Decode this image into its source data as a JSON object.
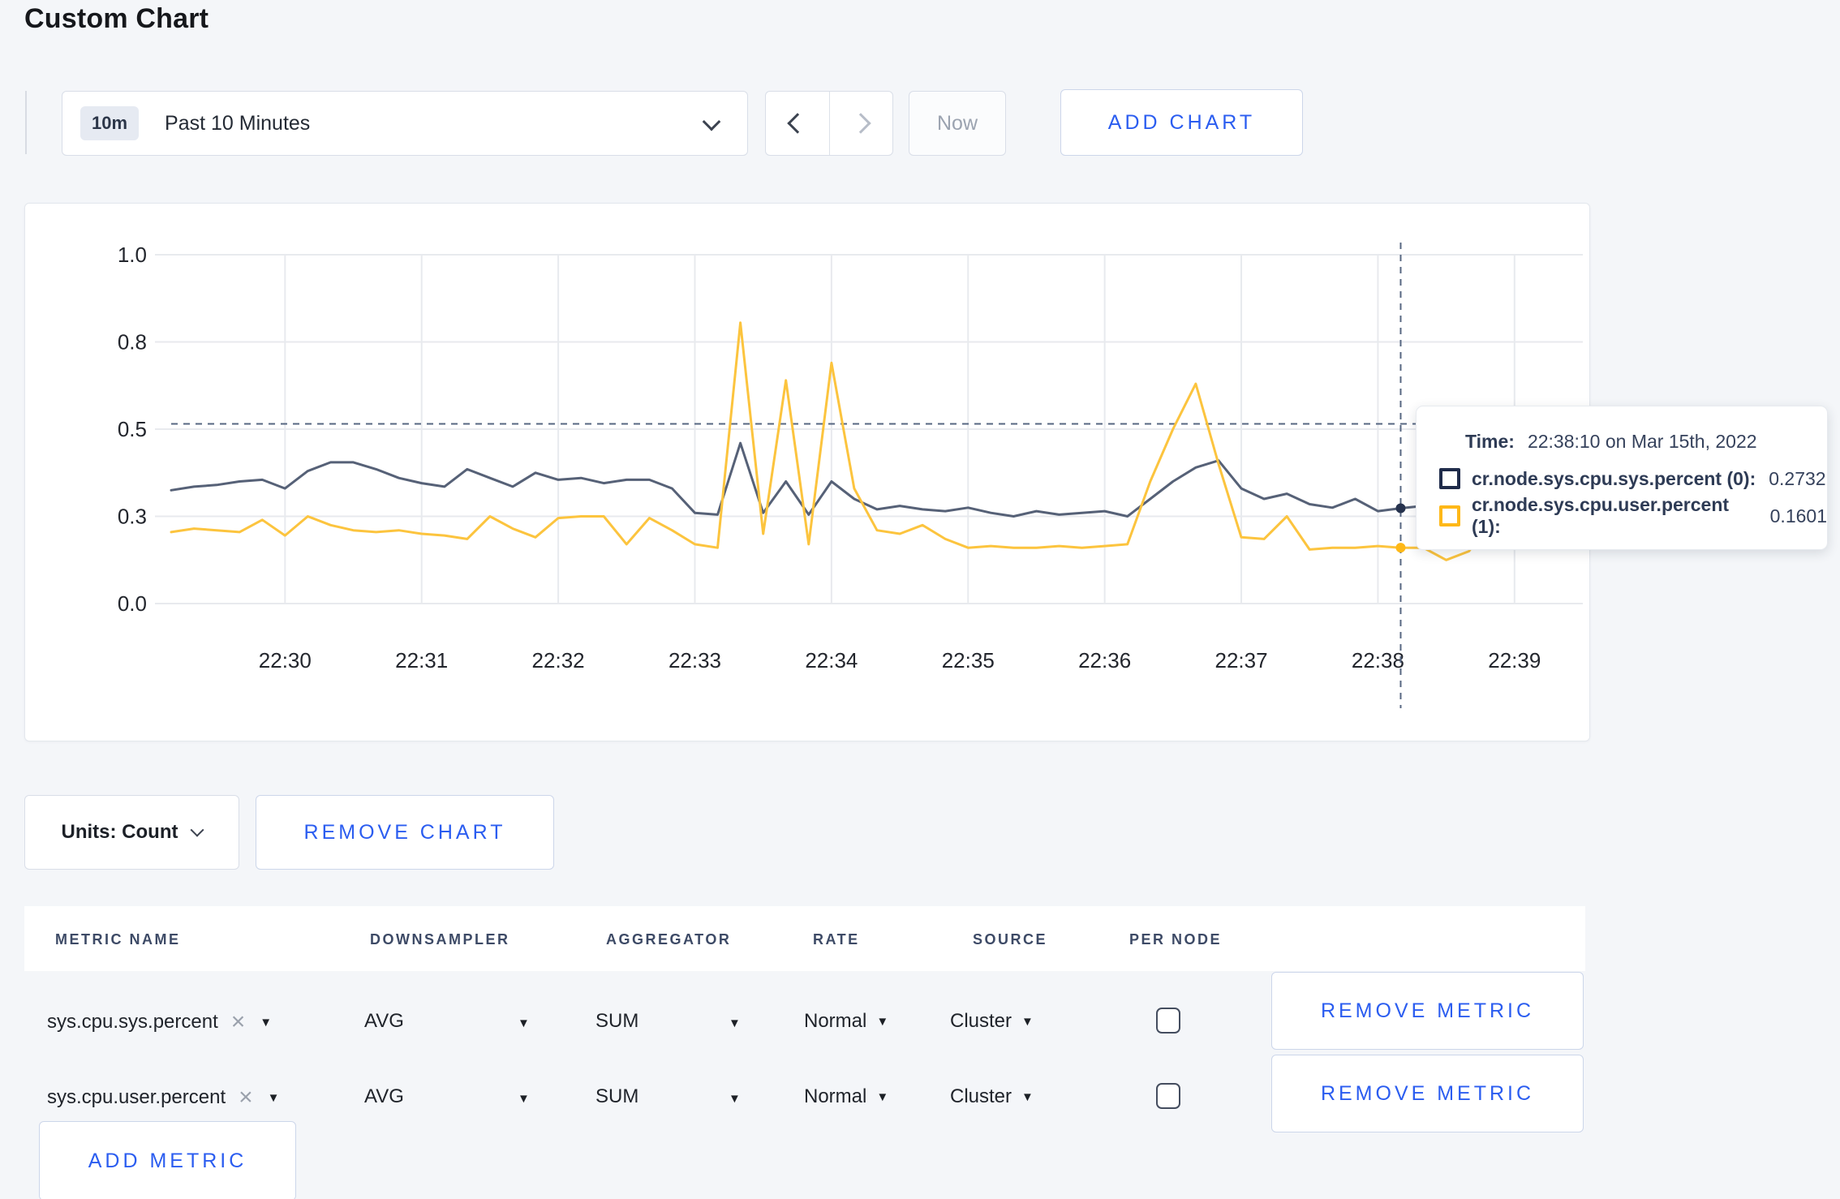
{
  "header": {
    "title": "Custom Chart"
  },
  "toolbar": {
    "range_badge": "10m",
    "range_label": "Past 10 Minutes",
    "now_label": "Now",
    "add_chart_label": "ADD CHART"
  },
  "tooltip": {
    "time_label": "Time:",
    "time_value": "22:38:10 on Mar 15th, 2022",
    "rows": [
      {
        "name": "cr.node.sys.cpu.sys.percent (0):",
        "value": "0.2732",
        "color": "#1f2b4a"
      },
      {
        "name": "cr.node.sys.cpu.user.percent (1):",
        "value": "0.1601",
        "color": "#feb818"
      }
    ]
  },
  "controls": {
    "units_label": "Units: Count",
    "remove_chart_label": "REMOVE CHART"
  },
  "metrics_table": {
    "columns": [
      "METRIC NAME",
      "DOWNSAMPLER",
      "AGGREGATOR",
      "RATE",
      "SOURCE",
      "PER NODE"
    ],
    "rows": [
      {
        "metric": "sys.cpu.sys.percent",
        "downsampler": "AVG",
        "aggregator": "SUM",
        "rate": "Normal",
        "source": "Cluster",
        "per_node": false,
        "remove_label": "REMOVE METRIC"
      },
      {
        "metric": "sys.cpu.user.percent",
        "downsampler": "AVG",
        "aggregator": "SUM",
        "rate": "Normal",
        "source": "Cluster",
        "per_node": false,
        "remove_label": "REMOVE METRIC"
      }
    ],
    "add_metric_label": "ADD METRIC"
  },
  "chart_data": {
    "type": "line",
    "title": "",
    "xlabel": "",
    "ylabel": "",
    "ylim": [
      0,
      1
    ],
    "grid": true,
    "x_start": "22:29:10",
    "x_step_seconds": 10,
    "x_ticks": [
      {
        "label": "22:30",
        "i": 5
      },
      {
        "label": "22:31",
        "i": 11
      },
      {
        "label": "22:32",
        "i": 17
      },
      {
        "label": "22:33",
        "i": 23
      },
      {
        "label": "22:34",
        "i": 29
      },
      {
        "label": "22:35",
        "i": 35
      },
      {
        "label": "22:36",
        "i": 41
      },
      {
        "label": "22:37",
        "i": 47
      },
      {
        "label": "22:38",
        "i": 53
      },
      {
        "label": "22:39",
        "i": 59
      }
    ],
    "y_ticks": [
      {
        "v": 0.0,
        "label": "0.0"
      },
      {
        "v": 0.25,
        "label": "0.3"
      },
      {
        "v": 0.5,
        "label": "0.5"
      },
      {
        "v": 0.75,
        "label": "0.8"
      },
      {
        "v": 1.0,
        "label": "1.0"
      }
    ],
    "series": [
      {
        "name": "cr.node.sys.cpu.sys.percent",
        "color": "#566177",
        "values": [
          0.325,
          0.335,
          0.34,
          0.35,
          0.355,
          0.33,
          0.38,
          0.405,
          0.405,
          0.385,
          0.36,
          0.345,
          0.335,
          0.385,
          0.36,
          0.335,
          0.375,
          0.355,
          0.36,
          0.345,
          0.355,
          0.355,
          0.33,
          0.26,
          0.255,
          0.46,
          0.26,
          0.35,
          0.255,
          0.35,
          0.3,
          0.27,
          0.28,
          0.27,
          0.265,
          0.275,
          0.26,
          0.25,
          0.265,
          0.255,
          0.26,
          0.265,
          0.25,
          0.3,
          0.35,
          0.39,
          0.41,
          0.33,
          0.3,
          0.315,
          0.285,
          0.275,
          0.3,
          0.265,
          0.2732,
          0.28,
          0.29,
          0.285,
          0.295,
          0.3,
          0.295,
          0.3,
          0.29
        ]
      },
      {
        "name": "cr.node.sys.cpu.user.percent",
        "color": "#fcc43e",
        "values": [
          0.205,
          0.215,
          0.21,
          0.205,
          0.24,
          0.195,
          0.25,
          0.225,
          0.21,
          0.205,
          0.21,
          0.2,
          0.195,
          0.185,
          0.25,
          0.215,
          0.19,
          0.245,
          0.25,
          0.25,
          0.17,
          0.245,
          0.21,
          0.17,
          0.16,
          0.805,
          0.2,
          0.64,
          0.17,
          0.69,
          0.33,
          0.21,
          0.2,
          0.225,
          0.185,
          0.16,
          0.165,
          0.16,
          0.16,
          0.165,
          0.16,
          0.165,
          0.17,
          0.35,
          0.5,
          0.63,
          0.4,
          0.19,
          0.185,
          0.25,
          0.155,
          0.16,
          0.16,
          0.165,
          0.1601,
          0.16,
          0.125,
          0.15,
          0.24,
          0.265,
          0.245,
          0.25,
          0.245
        ]
      }
    ],
    "crosshair": {
      "index": 54,
      "time": "22:38:10",
      "y_value": 0.515,
      "points": [
        {
          "value": 0.2732,
          "color": "#26324e"
        },
        {
          "value": 0.1601,
          "color": "#feb818"
        }
      ]
    },
    "legend_position": "tooltip"
  }
}
